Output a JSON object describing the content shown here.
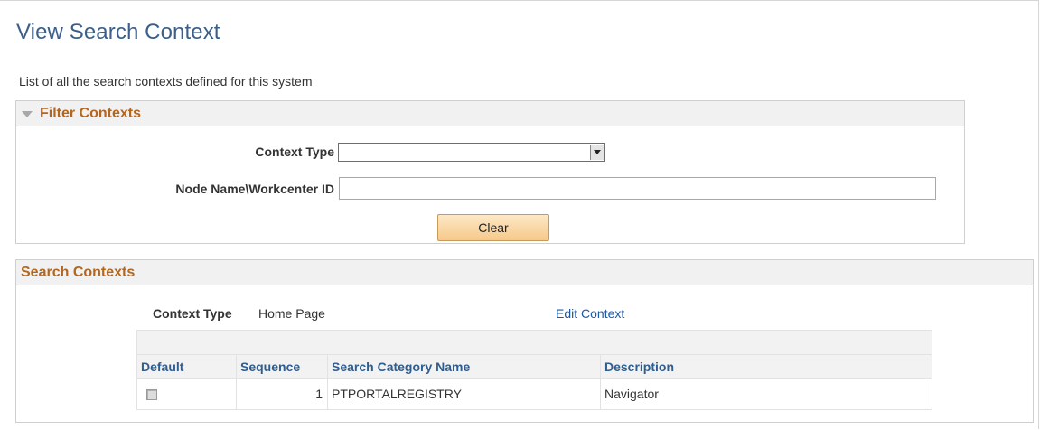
{
  "page": {
    "title": "View Search Context",
    "description": "List of all the search contexts defined for this system"
  },
  "filter": {
    "header": "Filter Contexts",
    "context_type_label": "Context Type",
    "context_type_value": "",
    "node_label": "Node Name\\Workcenter ID",
    "node_value": "",
    "clear_label": "Clear"
  },
  "contexts": {
    "header": "Search Contexts",
    "context_type_label": "Context Type",
    "context_type_value": "Home Page",
    "edit_link": "Edit Context",
    "columns": [
      "Default",
      "Sequence",
      "Search Category Name",
      "Description"
    ],
    "rows": [
      {
        "default": false,
        "sequence": "1",
        "category": "PTPORTALREGISTRY",
        "description": "Navigator"
      }
    ]
  }
}
